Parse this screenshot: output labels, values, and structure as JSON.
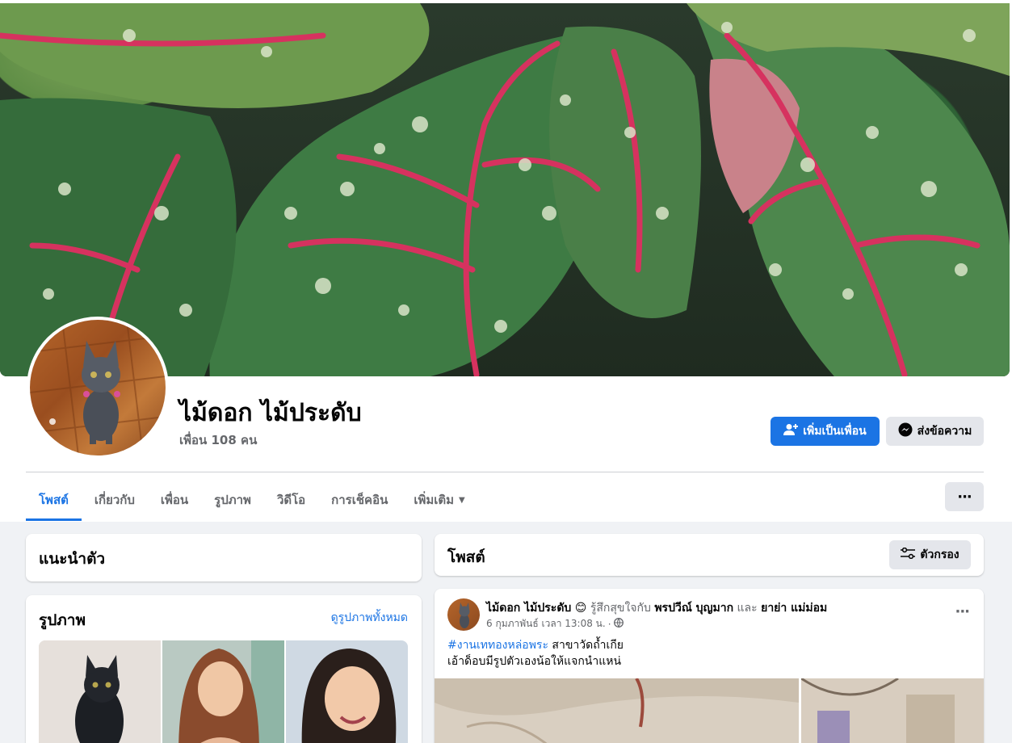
{
  "profile": {
    "name": "ไม้ดอก ไม้ประดับ",
    "friends": "เพื่อน 108 คน",
    "add_friend_label": "เพิ่มเป็นเพื่อน",
    "message_label": "ส่งข้อความ",
    "more_label": "···"
  },
  "tabs": [
    {
      "label": "โพสต์",
      "active": true
    },
    {
      "label": "เกี่ยวกับ"
    },
    {
      "label": "เพื่อน"
    },
    {
      "label": "รูปภาพ"
    },
    {
      "label": "วิดีโอ"
    },
    {
      "label": "การเช็คอิน"
    },
    {
      "label": "เพิ่มเติม"
    }
  ],
  "intro": {
    "title": "แนะนำตัว"
  },
  "photos": {
    "title": "รูปภาพ",
    "see_all": "ดูรูปภาพทั้งหมด"
  },
  "posts": {
    "title": "โพสต์",
    "filter_label": "ตัวกรอง"
  },
  "post": {
    "author": "ไม้ดอก ไม้ประดับ",
    "emoji": "😊",
    "feeling": "รู้สึกสุขใจกับ",
    "tagged1": "พรปวีณ์ บุญมาก",
    "and": "และ",
    "tagged2": "ยาย่า แม่ม่อม",
    "date": "6 กุมภาพันธ์ เวลา 13:08 น.",
    "dot": "·",
    "hashtag": "#งานเททองหล่อพระ",
    "line1_rest": " สาขาวัดถ้ำเกีย",
    "line2": "เอ้าด็อบมีรูปตัวเองน้อให้แจกนำแหน่",
    "more_label": "···"
  },
  "colors": {
    "accent": "#1b74e4",
    "background": "#f0f2f5",
    "muted": "#65676b"
  }
}
